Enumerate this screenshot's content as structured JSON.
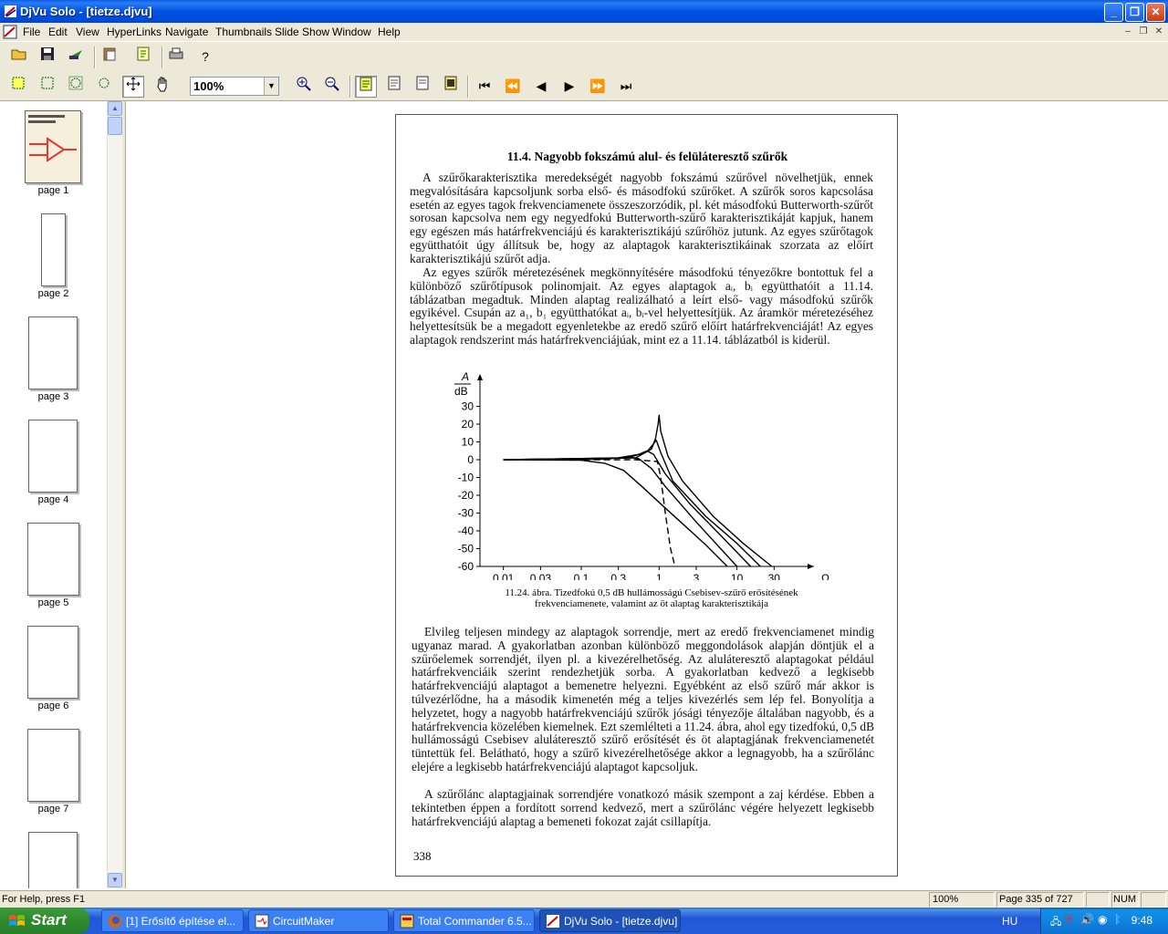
{
  "window": {
    "title": "DjVu Solo - [tietze.djvu]"
  },
  "menu": [
    "File",
    "Edit",
    "View",
    "HyperLinks",
    "Navigate",
    "Thumbnails",
    "Slide Show",
    "Window",
    "Help"
  ],
  "toolbar": {
    "zoom_value": "100%"
  },
  "thumbnails": [
    "page 1",
    "page 2",
    "page 3",
    "page 4",
    "page 5",
    "page 6",
    "page 7"
  ],
  "page": {
    "heading": "11.4.  Nagyobb fokszámú alul- és felüláteresztő szűrők",
    "para1": "A szűrőkarakterisztika meredekségét nagyobb fokszámú szűrővel növelhetjük, ennek megvalósítására kapcsoljunk sorba első- és másodfokú szűrőket. A szűrők soros kapcsolása esetén az egyes tagok frekvenciamenete összeszorzódik, pl. két másodfokú Butterworth-szűrőt sorosan kapcsolva nem egy negyedfokú Butterworth-szűrő karakterisztikáját kapjuk, hanem egy egészen más határfrekvenciájú és karakterisztikájú szűrőhöz jutunk. Az egyes szűrőtagok együtthatóit úgy állítsuk be, hogy az alaptagok karakterisztikáinak szorzata az előírt karakterisztikájú szűrőt adja.",
    "para2": "Az egyes szűrők méretezésének megkönnyítésére másodfokú tényezőkre bontottuk fel a különböző szűrőtípusok polinomjait. Az egyes alaptagok aᵢ, bᵢ együtthatóit a 11.14. táblázatban megadtuk. Minden alaptag realizálható a leírt első- vagy másodfokú szűrők egyikével. Csupán az a₁, b₁ együtthatókat aᵢ, bᵢ-vel helyettesítjük. Az áramkör méretezéséhez helyettesítsük be a megadott egyenletekbe az eredő szűrő előírt határfrekvenciáját! Az egyes alaptagok rendszerint más határfrekvenciájúak, mint ez a 11.14. táblázatból is kiderül.",
    "caption_line1": "11.24. ábra. Tizedfokú 0,5 dB hullámosságú Csebisev-szűrő erősítésének",
    "caption_line2": "frekvenciamenete, valamint az öt alaptag karakterisztikája",
    "para3": "Elvileg teljesen mindegy az alaptagok sorrendje, mert az eredő frekvenciamenet mindig ugyanaz marad. A gyakorlatban azonban különböző meggondolások alapján döntjük el a szűrőelemek sorrendjét, ilyen pl. a kivezérelhetőség. Az aluláteresztő alaptagokat például határfrekvenciáik szerint rendezhetjük sorba. A gyakorlatban kedvező a legkisebb határfrekvenciájú alaptagot a bemenetre helyezni. Egyébként az első szűrő már akkor is túlvezérlődne, ha a második kimenetén még a teljes kivezérlés sem lép fel. Bonyolítja a helyzetet, hogy a nagyobb határfrekvenciájú szűrők jósági tényezője általában nagyobb, és a határfrekvencia közelében kiemelnek. Ezt szemlélteti a 11.24. ábra, ahol egy tizedfokú, 0,5 dB hullámosságú Csebisev aluláteresztő szűrő erősítését és öt alaptagjának frekvenciamenetét tüntettük fel. Belátható, hogy a szűrő kivezérelhetősége akkor a legnagyobb, ha a szűrőlánc elejére a legkisebb határfrekvenciájú alaptagot kapcsoljuk.",
    "para4": "A szűrőlánc alaptagjainak sorrendjére vonatkozó másik szempont a zaj kérdése. Ebben a tekintetben éppen a fordított sorrend kedvező, mert a szűrőlánc végére helyezett legkisebb határfrekvenciájú alaptag a bemeneti fokozat zaját csillapítja.",
    "page_number": "338"
  },
  "chart_data": {
    "type": "line",
    "ylabel_top": "A",
    "ylabel_bottom": "dB",
    "xlabel": "Ω",
    "x_ticks": [
      "0,01",
      "0,03",
      "0,1",
      "0,3",
      "1",
      "3",
      "10",
      "30"
    ],
    "x_tick_values": [
      0.01,
      0.03,
      0.1,
      0.3,
      1,
      3,
      10,
      30
    ],
    "y_ticks": [
      "30",
      "20",
      "10",
      "0",
      "-10",
      "-20",
      "-30",
      "-40",
      "-50",
      "-60"
    ],
    "y_tick_values": [
      30,
      20,
      10,
      0,
      -10,
      -20,
      -30,
      -40,
      -50,
      -60
    ],
    "xlim": [
      0.005,
      60
    ],
    "ylim": [
      -60,
      40
    ],
    "series": [
      {
        "style": "dashed",
        "points": [
          [
            0.01,
            0
          ],
          [
            0.5,
            0
          ],
          [
            0.95,
            -1
          ],
          [
            1.05,
            -10
          ],
          [
            1.2,
            -30
          ],
          [
            1.4,
            -50
          ],
          [
            1.6,
            -60
          ]
        ]
      },
      {
        "style": "solid",
        "points": [
          [
            0.01,
            0
          ],
          [
            0.1,
            -0.3
          ],
          [
            0.2,
            -2
          ],
          [
            0.35,
            -6
          ],
          [
            0.6,
            -15
          ],
          [
            1,
            -24
          ],
          [
            2,
            -36
          ],
          [
            4,
            -48
          ],
          [
            7.5,
            -60
          ]
        ]
      },
      {
        "style": "solid",
        "points": [
          [
            0.01,
            0
          ],
          [
            0.2,
            0.3
          ],
          [
            0.4,
            1.5
          ],
          [
            0.55,
            0.5
          ],
          [
            0.8,
            -5
          ],
          [
            1.2,
            -15
          ],
          [
            3,
            -35
          ],
          [
            10,
            -60
          ]
        ]
      },
      {
        "style": "solid",
        "points": [
          [
            0.01,
            0
          ],
          [
            0.3,
            1
          ],
          [
            0.55,
            3
          ],
          [
            0.7,
            5
          ],
          [
            0.85,
            3
          ],
          [
            1.2,
            -8
          ],
          [
            2.5,
            -25
          ],
          [
            6,
            -42
          ],
          [
            15,
            -60
          ]
        ]
      },
      {
        "style": "solid",
        "points": [
          [
            0.01,
            0
          ],
          [
            0.4,
            1
          ],
          [
            0.7,
            4.5
          ],
          [
            0.85,
            9
          ],
          [
            0.92,
            11
          ],
          [
            1.05,
            4
          ],
          [
            1.5,
            -12
          ],
          [
            4,
            -32
          ],
          [
            10,
            -47
          ],
          [
            20,
            -60
          ]
        ]
      },
      {
        "style": "solid",
        "points": [
          [
            0.01,
            0
          ],
          [
            0.5,
            1
          ],
          [
            0.8,
            6
          ],
          [
            0.9,
            12
          ],
          [
            0.97,
            20
          ],
          [
            1,
            25
          ],
          [
            1.05,
            16
          ],
          [
            1.3,
            2
          ],
          [
            2,
            -12
          ],
          [
            5,
            -32
          ],
          [
            12,
            -47
          ],
          [
            28,
            -60
          ]
        ]
      }
    ]
  },
  "status": {
    "help": "For Help, press F1",
    "zoom": "100%",
    "page": "Page 335 of 727",
    "num": "NUM"
  },
  "taskbar": {
    "start": "Start",
    "tasks": [
      "[1] Erősítő építése el...",
      "CircuitMaker",
      "Total Commander 6.5...",
      "DjVu Solo - [tietze.djvu]"
    ],
    "lang": "HU",
    "clock": "9:48"
  }
}
